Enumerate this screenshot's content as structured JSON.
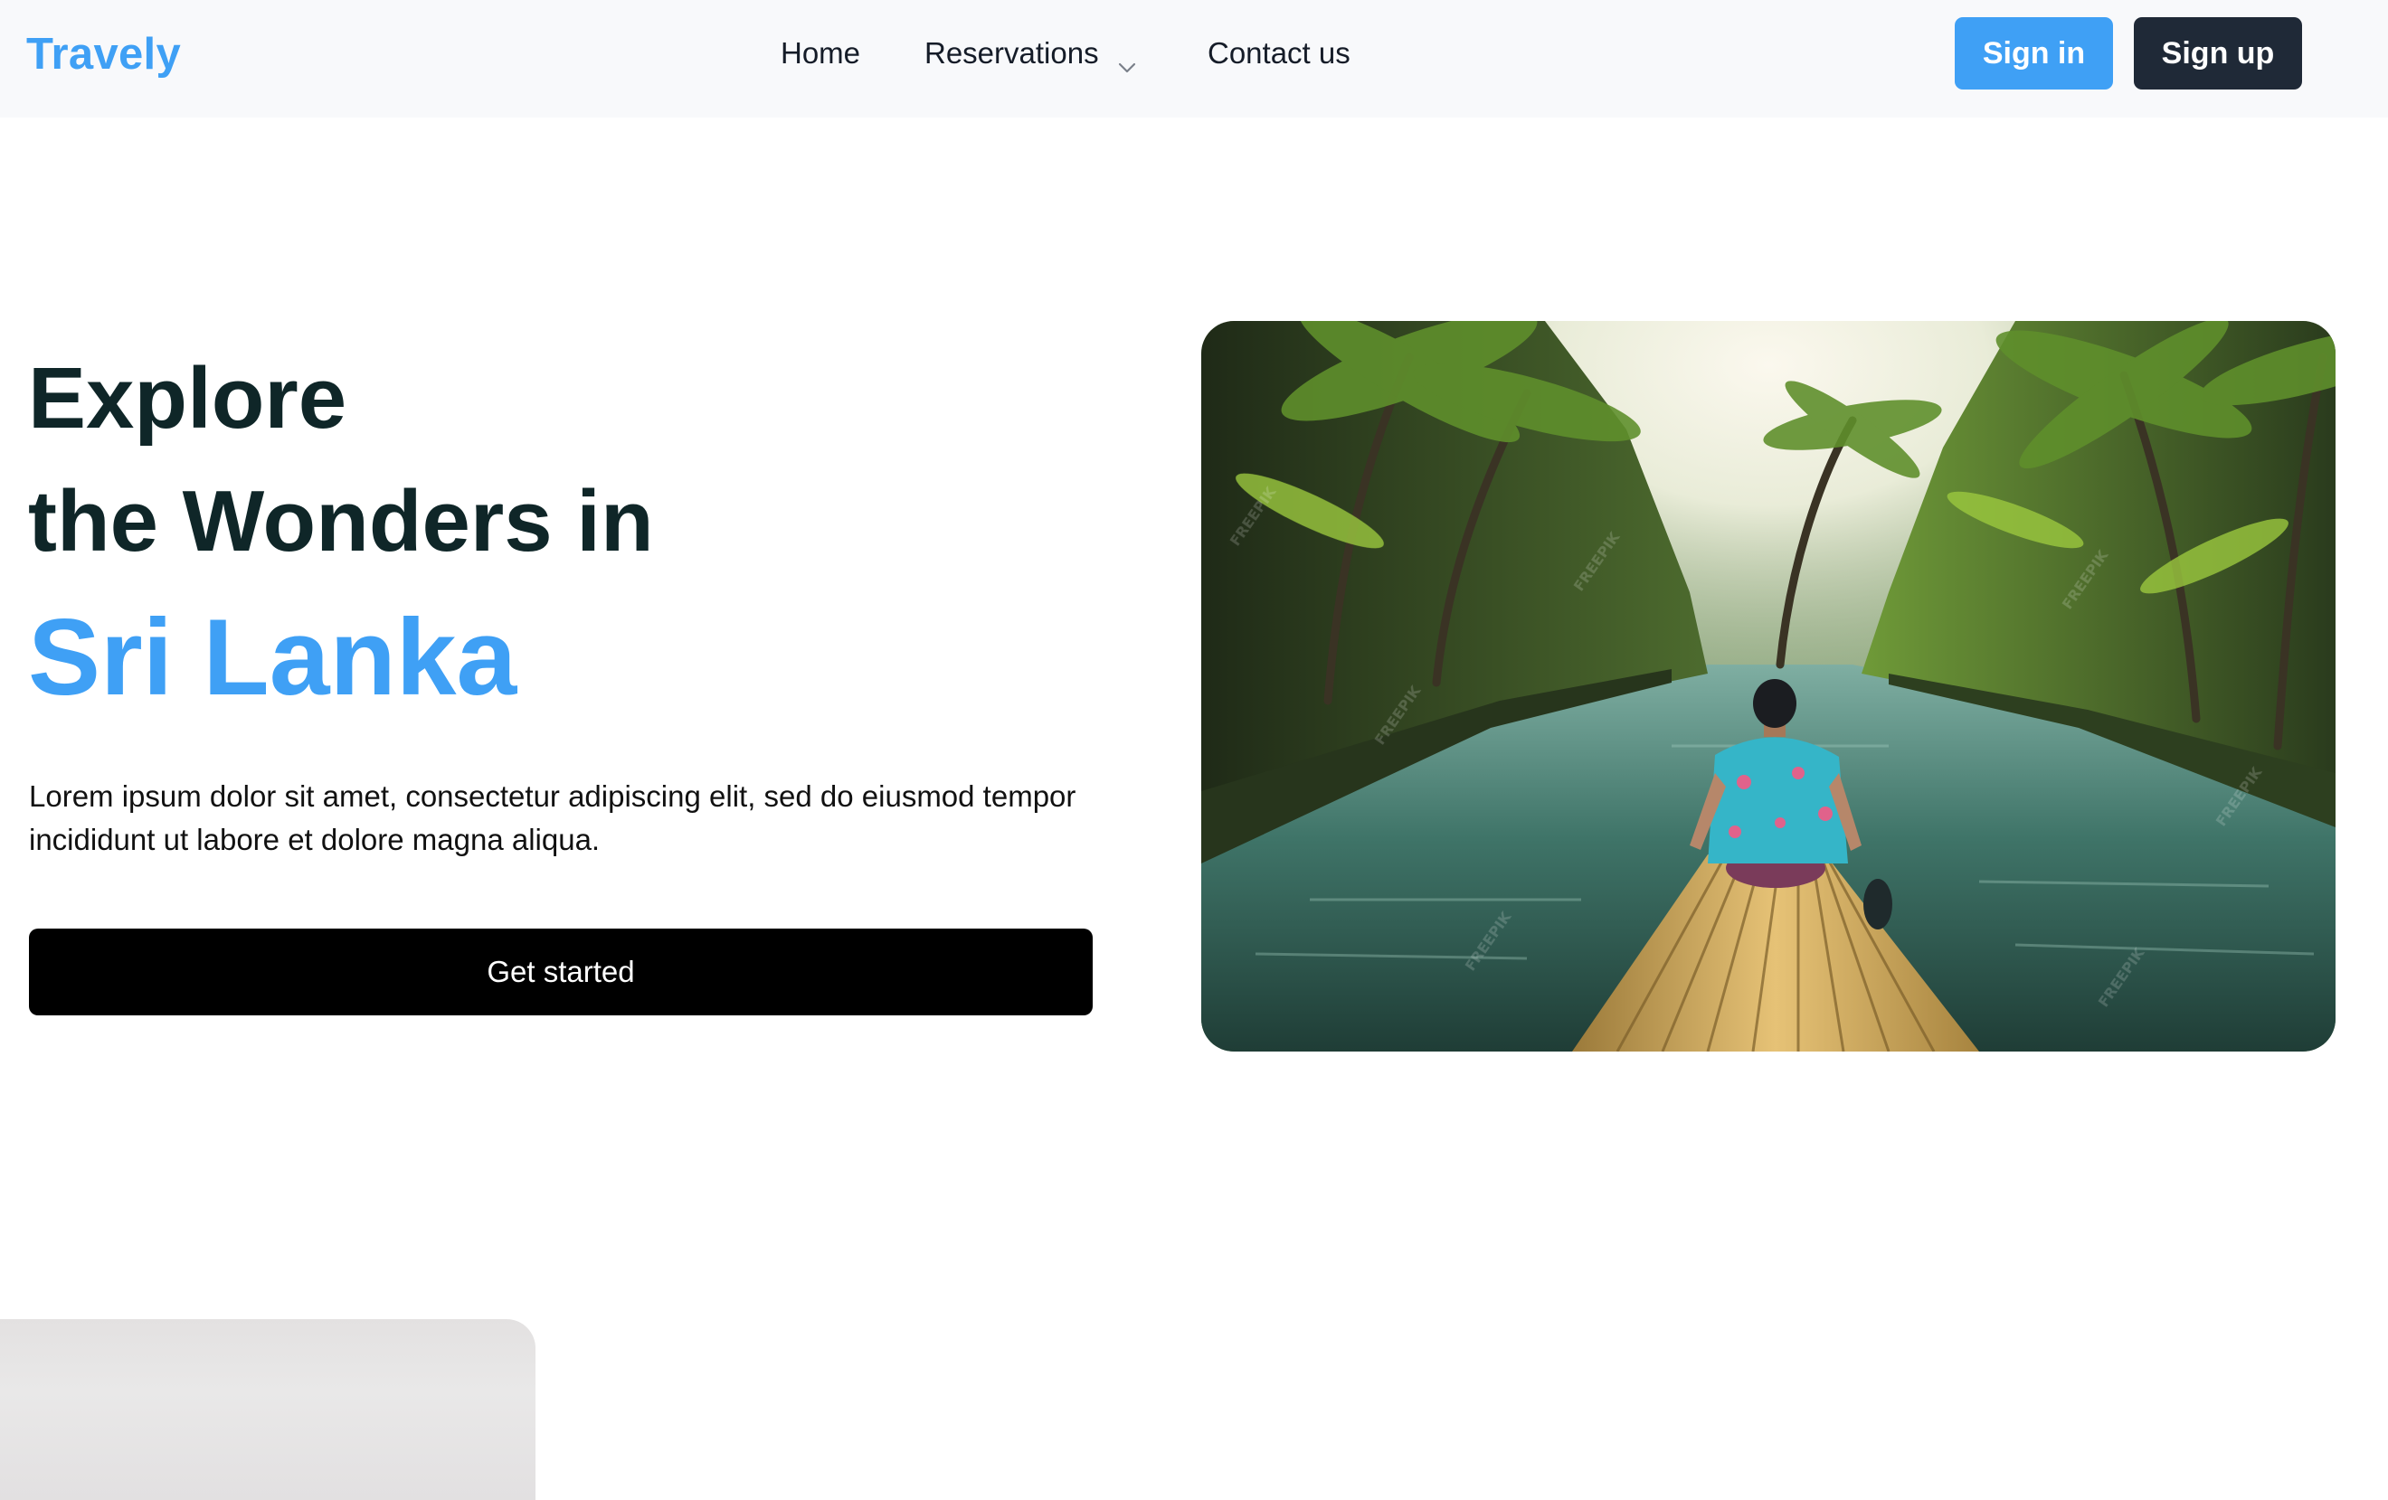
{
  "brand": {
    "name": "Travely",
    "accent_color": "#3fa0f5"
  },
  "nav": {
    "items": [
      {
        "label": "Home"
      },
      {
        "label": "Reservations",
        "icon": "chevron-down-icon"
      },
      {
        "label": "Contact us"
      }
    ]
  },
  "auth": {
    "signin_label": "Sign in",
    "signup_label": "Sign up"
  },
  "hero": {
    "line1": "Explore",
    "line2": "the Wonders in",
    "highlight": "Sri Lanka",
    "description": "Lorem ipsum dolor sit amet, consectetur adipiscing elit, sed do eiusmod tempor incididunt ut labore et dolore magna aliqua.",
    "cta_label": "Get started",
    "image_subject": "traveler sitting on a bamboo raft on a river lined with palm trees",
    "watermark": "FREEPIK"
  }
}
